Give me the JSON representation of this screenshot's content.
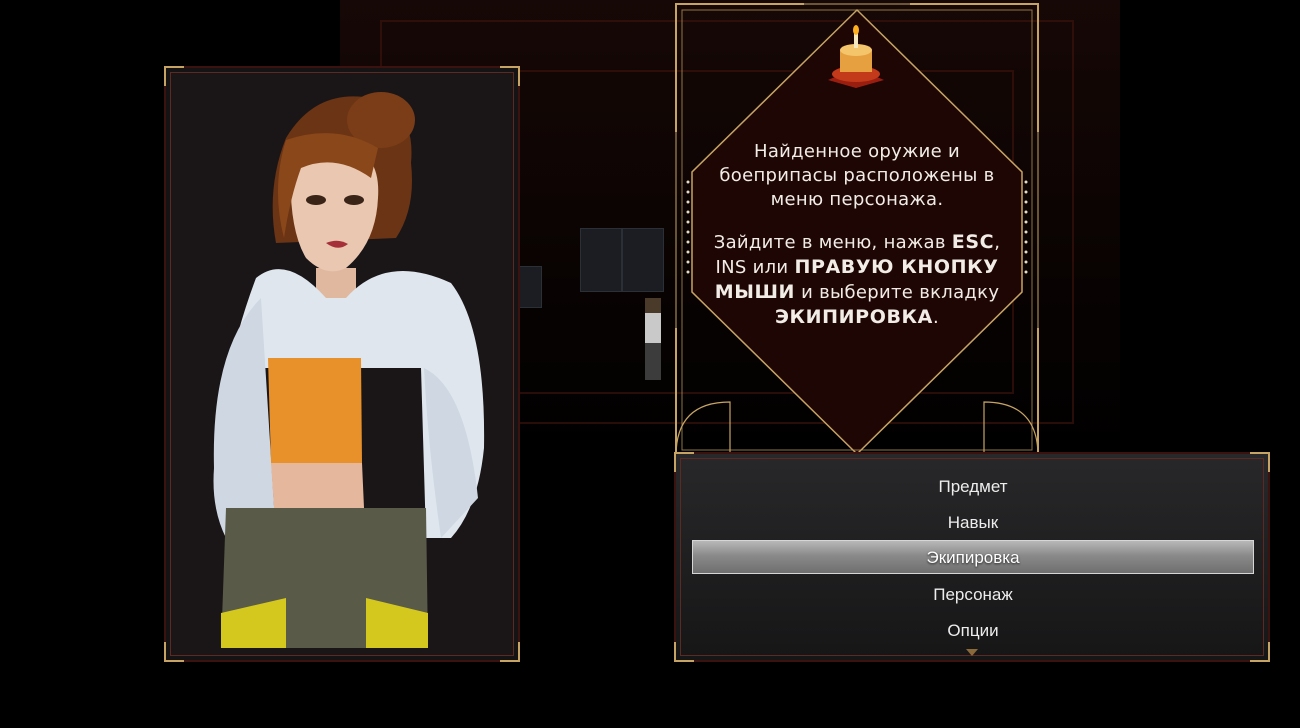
{
  "tooltip": {
    "line1": "Найденное оружие и",
    "line2": "боеприпасы расположены в",
    "line3": "меню персонажа.",
    "line4a": "Зайдите в меню, нажав ",
    "line4b": "ESC",
    "line4c": ",",
    "line5a": "INS",
    "line5b": " или ",
    "line5c": "ПРАВУЮ КНОПКУ",
    "line6a": "МЫШИ",
    "line6b": " и выберите вкладку",
    "line7a": "ЭКИПИРОВКА",
    "line7b": ".",
    "icon": "cake-icon"
  },
  "menu": {
    "items": [
      {
        "label": "Предмет",
        "selected": false
      },
      {
        "label": "Навык",
        "selected": false
      },
      {
        "label": "Экипировка",
        "selected": true
      },
      {
        "label": "Персонаж",
        "selected": false
      },
      {
        "label": "Опции",
        "selected": false
      }
    ]
  },
  "colors": {
    "gold": "#c7a464",
    "panel_border": "#3b1210",
    "tooltip_bg": "#1e0605"
  }
}
